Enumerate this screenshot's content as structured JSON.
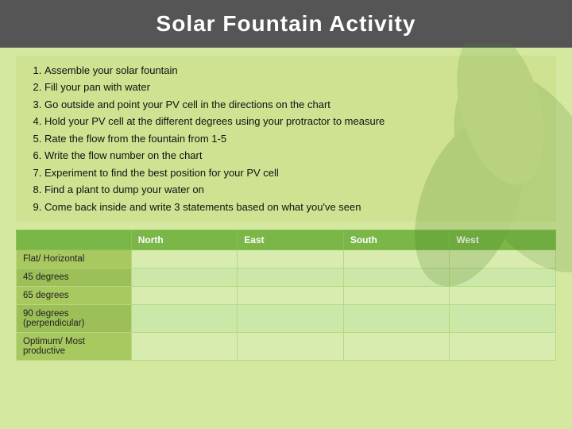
{
  "header": {
    "title": "Solar Fountain Activity"
  },
  "instructions": {
    "items": [
      "Assemble your solar fountain",
      "Fill your pan with water",
      "Go outside and point your PV cell in the directions on the chart",
      "Hold your PV cell at the different degrees using your protractor to measure",
      "Rate the flow from the fountain from 1-5",
      "Write the flow number on the chart",
      "Experiment to find the best position for your PV cell",
      "Find a plant to dump your water on",
      "Come back inside and write 3 statements based on what you've seen"
    ]
  },
  "table": {
    "columns": [
      "",
      "North",
      "East",
      "South",
      "West"
    ],
    "rows": [
      {
        "label": "Flat/ Horizontal",
        "cells": [
          "",
          "",
          "",
          ""
        ]
      },
      {
        "label": "45 degrees",
        "cells": [
          "",
          "",
          "",
          ""
        ]
      },
      {
        "label": "65 degrees",
        "cells": [
          "",
          "",
          "",
          ""
        ]
      },
      {
        "label": "90 degrees (perpendicular)",
        "cells": [
          "",
          "",
          "",
          ""
        ]
      },
      {
        "label": "Optimum/ Most productive",
        "cells": [
          "",
          "",
          "",
          ""
        ]
      }
    ]
  }
}
